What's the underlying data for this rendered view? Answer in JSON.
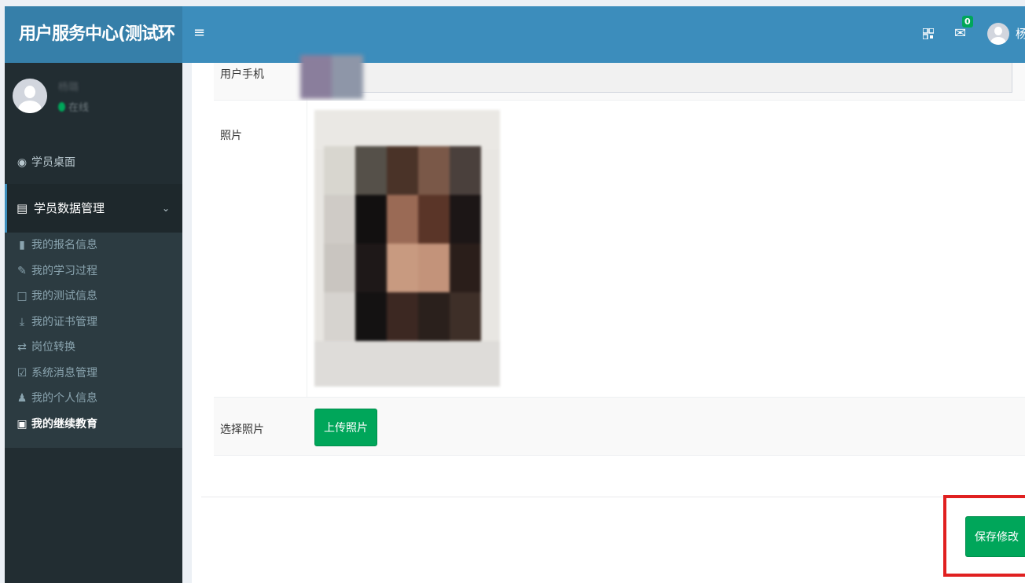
{
  "app": {
    "brand": "用户服务中心(测试环"
  },
  "user": {
    "name": "杨璐",
    "status": "在线",
    "header_name": "杨"
  },
  "sidebar": {
    "top_item": "学员桌面",
    "active_group": "学员数据管理",
    "items": [
      {
        "label": "我的报名信息",
        "icon": "file-icon"
      },
      {
        "label": "我的学习过程",
        "icon": "edit-icon"
      },
      {
        "label": "我的测试信息",
        "icon": "monitor-icon"
      },
      {
        "label": "我的证书管理",
        "icon": "download-icon"
      },
      {
        "label": "岗位转换",
        "icon": "exchange-icon"
      },
      {
        "label": "系统消息管理",
        "icon": "checkbox-icon"
      },
      {
        "label": "我的个人信息",
        "icon": "user-icon"
      },
      {
        "label": "我的继续教育",
        "icon": "image-icon"
      }
    ]
  },
  "header": {
    "mail_count": "0"
  },
  "form": {
    "phone_label": "用户手机",
    "photo_label": "照片",
    "choose_photo_label": "选择照片",
    "upload_button": "上传照片"
  },
  "actions": {
    "save_button": "保存修改"
  },
  "colors": {
    "accent": "#3c8dbc",
    "brand_bg": "#367fa9",
    "sidebar_bg": "#222d32",
    "success": "#00a65a",
    "highlight": "#e02020"
  }
}
